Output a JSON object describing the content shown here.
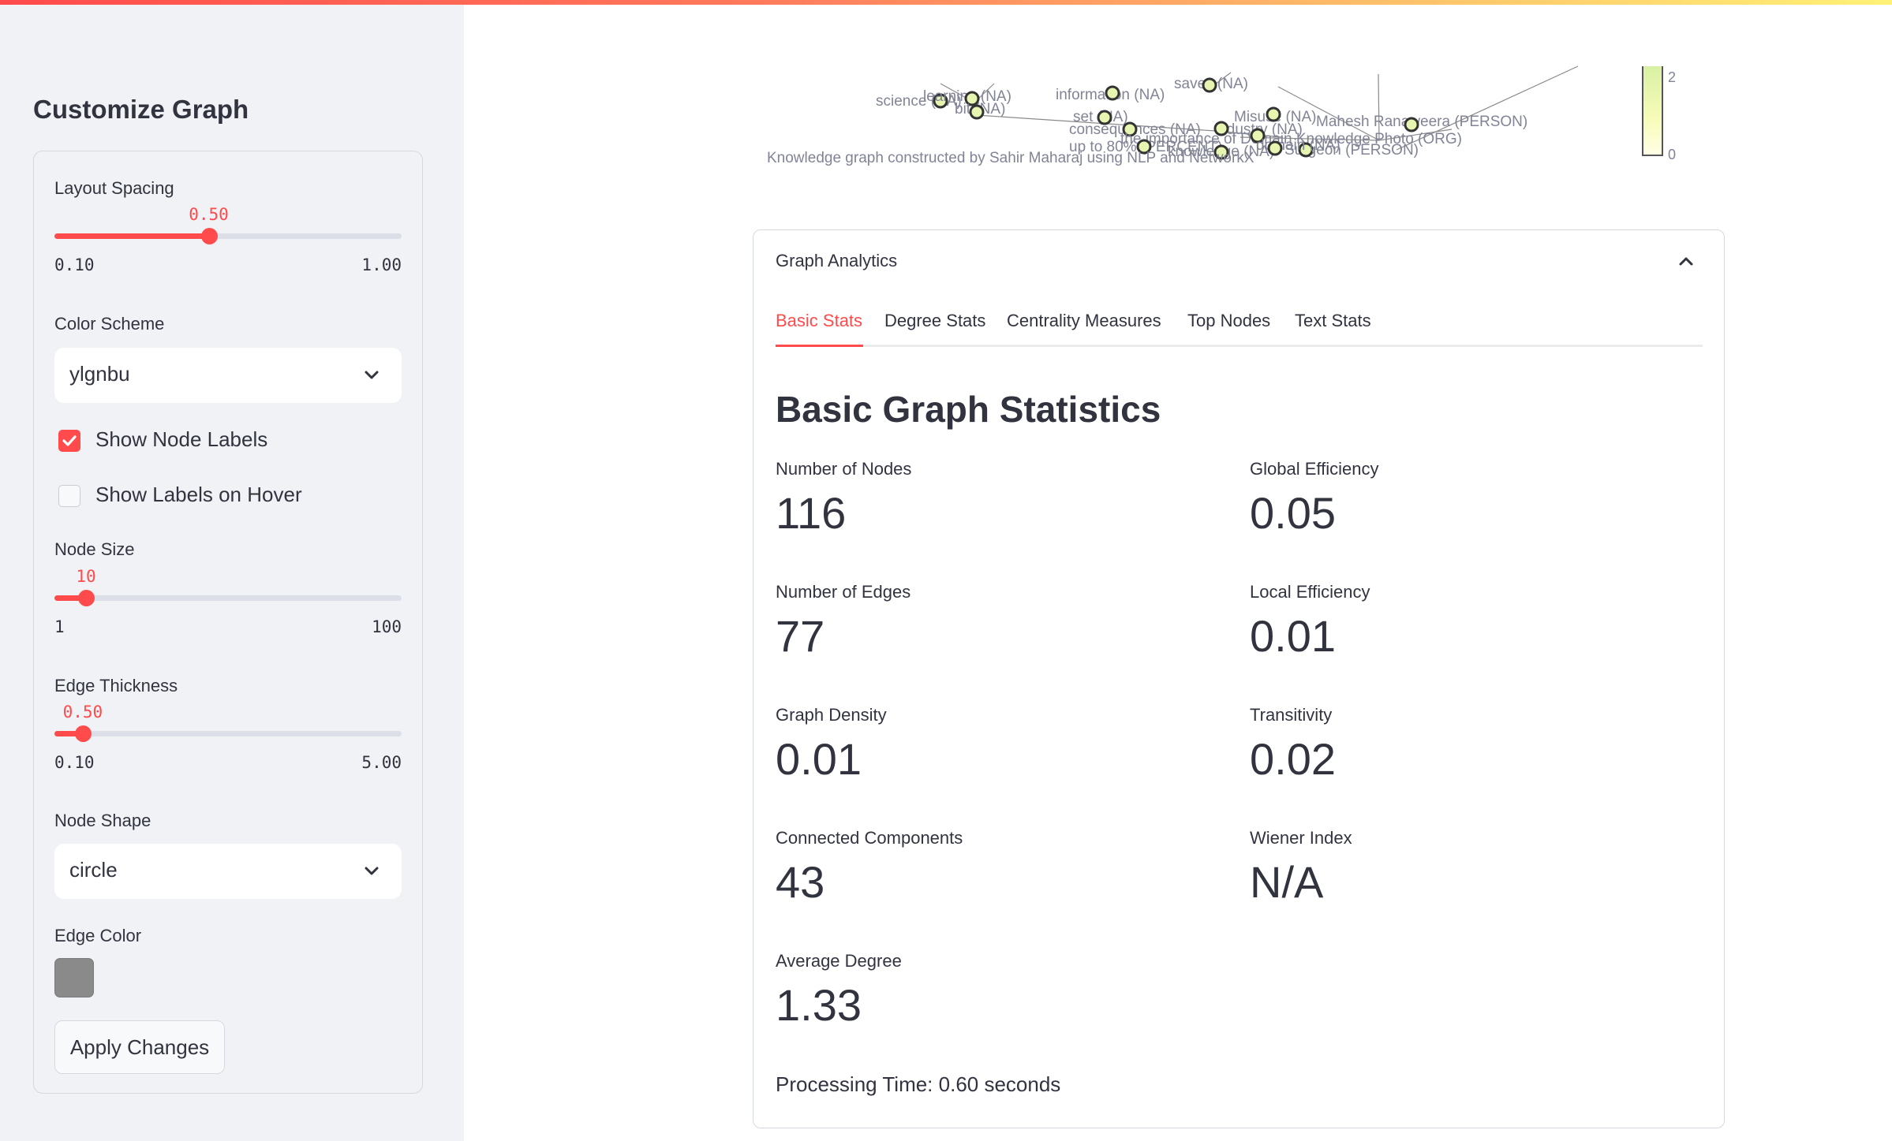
{
  "theme": {
    "accent": "#ff4b4b",
    "edge_color": "#8a8a8a"
  },
  "sidebar": {
    "title": "Customize Graph",
    "layout_spacing": {
      "label": "Layout Spacing",
      "value": 0.5,
      "value_text": "0.50",
      "min": 0.1,
      "min_text": "0.10",
      "max": 1.0,
      "max_text": "1.00"
    },
    "color_scheme": {
      "label": "Color Scheme",
      "selected": "ylgnbu"
    },
    "show_node_labels": {
      "label": "Show Node Labels",
      "checked": true
    },
    "show_labels_on_hover": {
      "label": "Show Labels on Hover",
      "checked": false
    },
    "node_size": {
      "label": "Node Size",
      "value": 10,
      "value_text": "10",
      "min": 1,
      "min_text": "1",
      "max": 100,
      "max_text": "100"
    },
    "edge_thickness": {
      "label": "Edge Thickness",
      "value": 0.5,
      "value_text": "0.50",
      "min": 0.1,
      "min_text": "0.10",
      "max": 5.0,
      "max_text": "5.00"
    },
    "node_shape": {
      "label": "Node Shape",
      "selected": "circle"
    },
    "edge_color": {
      "label": "Edge Color",
      "value": "#8a8a8a"
    },
    "apply_label": "Apply Changes"
  },
  "graph": {
    "caption": "Knowledge graph constructed by Sahir Maharaj using NLP and NetworkX",
    "colorbar": {
      "max_label": "2",
      "min_label": "0"
    },
    "node_labels": [
      "science (NA)",
      "learning (NA)",
      "bit (NA)",
      "information (NA)",
      "saves (NA)",
      "set (NA)",
      "consequences (NA)",
      "industry (NA)",
      "the importance of Domain Knowledge Photo (ORG)",
      "up to 80% (PERCENT)",
      "knowledge (NA)",
      "Misuse (NA)",
      "Mahesh Ranaweera (PERSON)",
      "Surgeon (PERSON)",
      "domain (NA)"
    ]
  },
  "analytics": {
    "title": "Graph Analytics",
    "tabs": [
      {
        "label": "Basic Stats",
        "active": true
      },
      {
        "label": "Degree Stats",
        "active": false
      },
      {
        "label": "Centrality Measures",
        "active": false
      },
      {
        "label": "Top Nodes",
        "active": false
      },
      {
        "label": "Text Stats",
        "active": false
      }
    ],
    "section_title": "Basic Graph Statistics",
    "metrics": [
      {
        "label": "Number of Nodes",
        "value": "116"
      },
      {
        "label": "Global Efficiency",
        "value": "0.05"
      },
      {
        "label": "Number of Edges",
        "value": "77"
      },
      {
        "label": "Local Efficiency",
        "value": "0.01"
      },
      {
        "label": "Graph Density",
        "value": "0.01"
      },
      {
        "label": "Transitivity",
        "value": "0.02"
      },
      {
        "label": "Connected Components",
        "value": "43"
      },
      {
        "label": "Wiener Index",
        "value": "N/A"
      },
      {
        "label": "Average Degree",
        "value": "1.33"
      }
    ],
    "processing_time": "Processing Time: 0.60 seconds"
  }
}
